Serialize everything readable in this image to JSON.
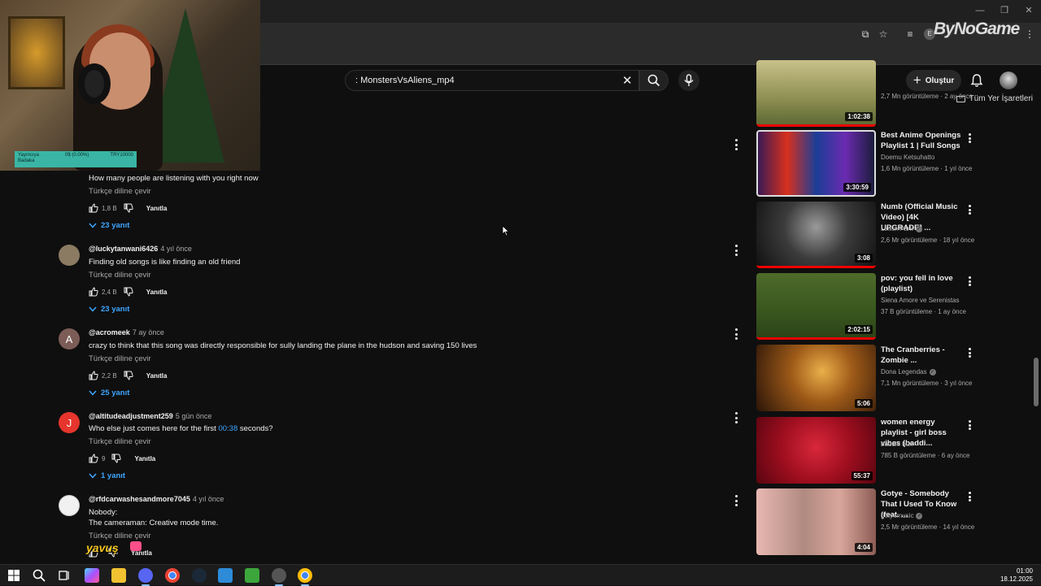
{
  "browser": {
    "bookmarks_label": "Tüm Yer İşaretleri",
    "watermark": "ByNoGame",
    "profile_initial": "E"
  },
  "webcam": {
    "bar_left": "Yayıncıya\nBadaka",
    "bar_mid": "0$ (0.00%)",
    "bar_right": "TRY10000"
  },
  "header": {
    "search_value": ": MonstersVsAliens_mp4",
    "create_label": "Oluştur"
  },
  "comments": [
    {
      "user": "",
      "ago": "",
      "text": "How many people are listening with you right now",
      "translate": "Türkçe diline çevir",
      "likes": "1,8 B",
      "reply_label": "Yanıtla",
      "replies": "23 yanıt",
      "avatar_letter": "",
      "avatar_color": "#444"
    },
    {
      "user": "@luckytanwani6426",
      "ago": "4 yıl önce",
      "text": "Finding old songs is like finding an old friend",
      "translate": "Türkçe diline çevir",
      "likes": "2,4 B",
      "reply_label": "Yanıtla",
      "replies": "23 yanıt",
      "avatar_letter": "",
      "avatar_color": "#8b7b62"
    },
    {
      "user": "@acromeek",
      "ago": "7 ay önce",
      "text": "crazy to think that this song was directly responsible for sully landing the plane in the hudson and saving 150 lives",
      "translate": "Türkçe diline çevir",
      "likes": "2,2 B",
      "reply_label": "Yanıtla",
      "replies": "25 yanıt",
      "avatar_letter": "A",
      "avatar_color": "#7c5c56"
    },
    {
      "user": "@altitudeadjustment259",
      "ago": "5 gün önce",
      "text_before": "Who else just comes here for the first ",
      "text_ts": "00:38",
      "text_after": " seconds?",
      "translate": "Türkçe diline çevir",
      "likes": "9",
      "reply_label": "Yanıtla",
      "replies": "1 yanıt",
      "avatar_letter": "J",
      "avatar_color": "#e5352c"
    },
    {
      "user": "@rfdcarwashesandmore7045",
      "ago": "4 yıl önce",
      "text": "Nobody:",
      "text2": "The cameraman: Creative mode time.",
      "translate": "Türkçe diline çevir",
      "likes": "",
      "reply_label": "Yanıtla",
      "avatar_letter": "",
      "avatar_color": "#f1f1f1"
    }
  ],
  "sidebar": [
    {
      "title": "",
      "channel": "",
      "meta": "2,7 Mn görüntüleme · 2 ay önce",
      "duration": "1:02:38",
      "verified": false
    },
    {
      "title": "Best Anime Openings Playlist 1 | Full Songs",
      "channel": "Doemu Ketsuhatto",
      "meta": "1,6 Mn görüntüleme · 1 yıl önce",
      "duration": "3:30:59",
      "verified": false
    },
    {
      "title": "Numb (Official Music Video) [4K UPGRADE] ...",
      "channel": "Linkin Park",
      "meta": "2,6 Mr görüntüleme · 18 yıl önce",
      "duration": "3:08",
      "verified": true
    },
    {
      "title": "pov: you fell in love (playlist)",
      "channel": "Siena Amore ve Serenistas",
      "meta": "37 B görüntüleme · 1 ay önce",
      "duration": "2:02:15",
      "verified": false
    },
    {
      "title": "The Cranberries - Zombie ...",
      "channel": "Dona Legendas",
      "meta": "7,1 Mn görüntüleme · 3 yıl önce",
      "duration": "5:06",
      "verified": true
    },
    {
      "title": "women energy playlist - girl boss vibes (baddi...",
      "channel": "baddie bun",
      "meta": "785 B görüntüleme · 6 ay önce",
      "duration": "55:37",
      "verified": false
    },
    {
      "title": "Gotye - Somebody That I Used To Know (feat. ...",
      "channel": "gotyemusic",
      "meta": "2,5 Mr görüntüleme · 14 yıl önce",
      "duration": "4:04",
      "verified": true
    }
  ],
  "overlay": {
    "name": "yavuş"
  },
  "taskbar": {
    "time": "01:00",
    "date": "18.12.2025"
  }
}
